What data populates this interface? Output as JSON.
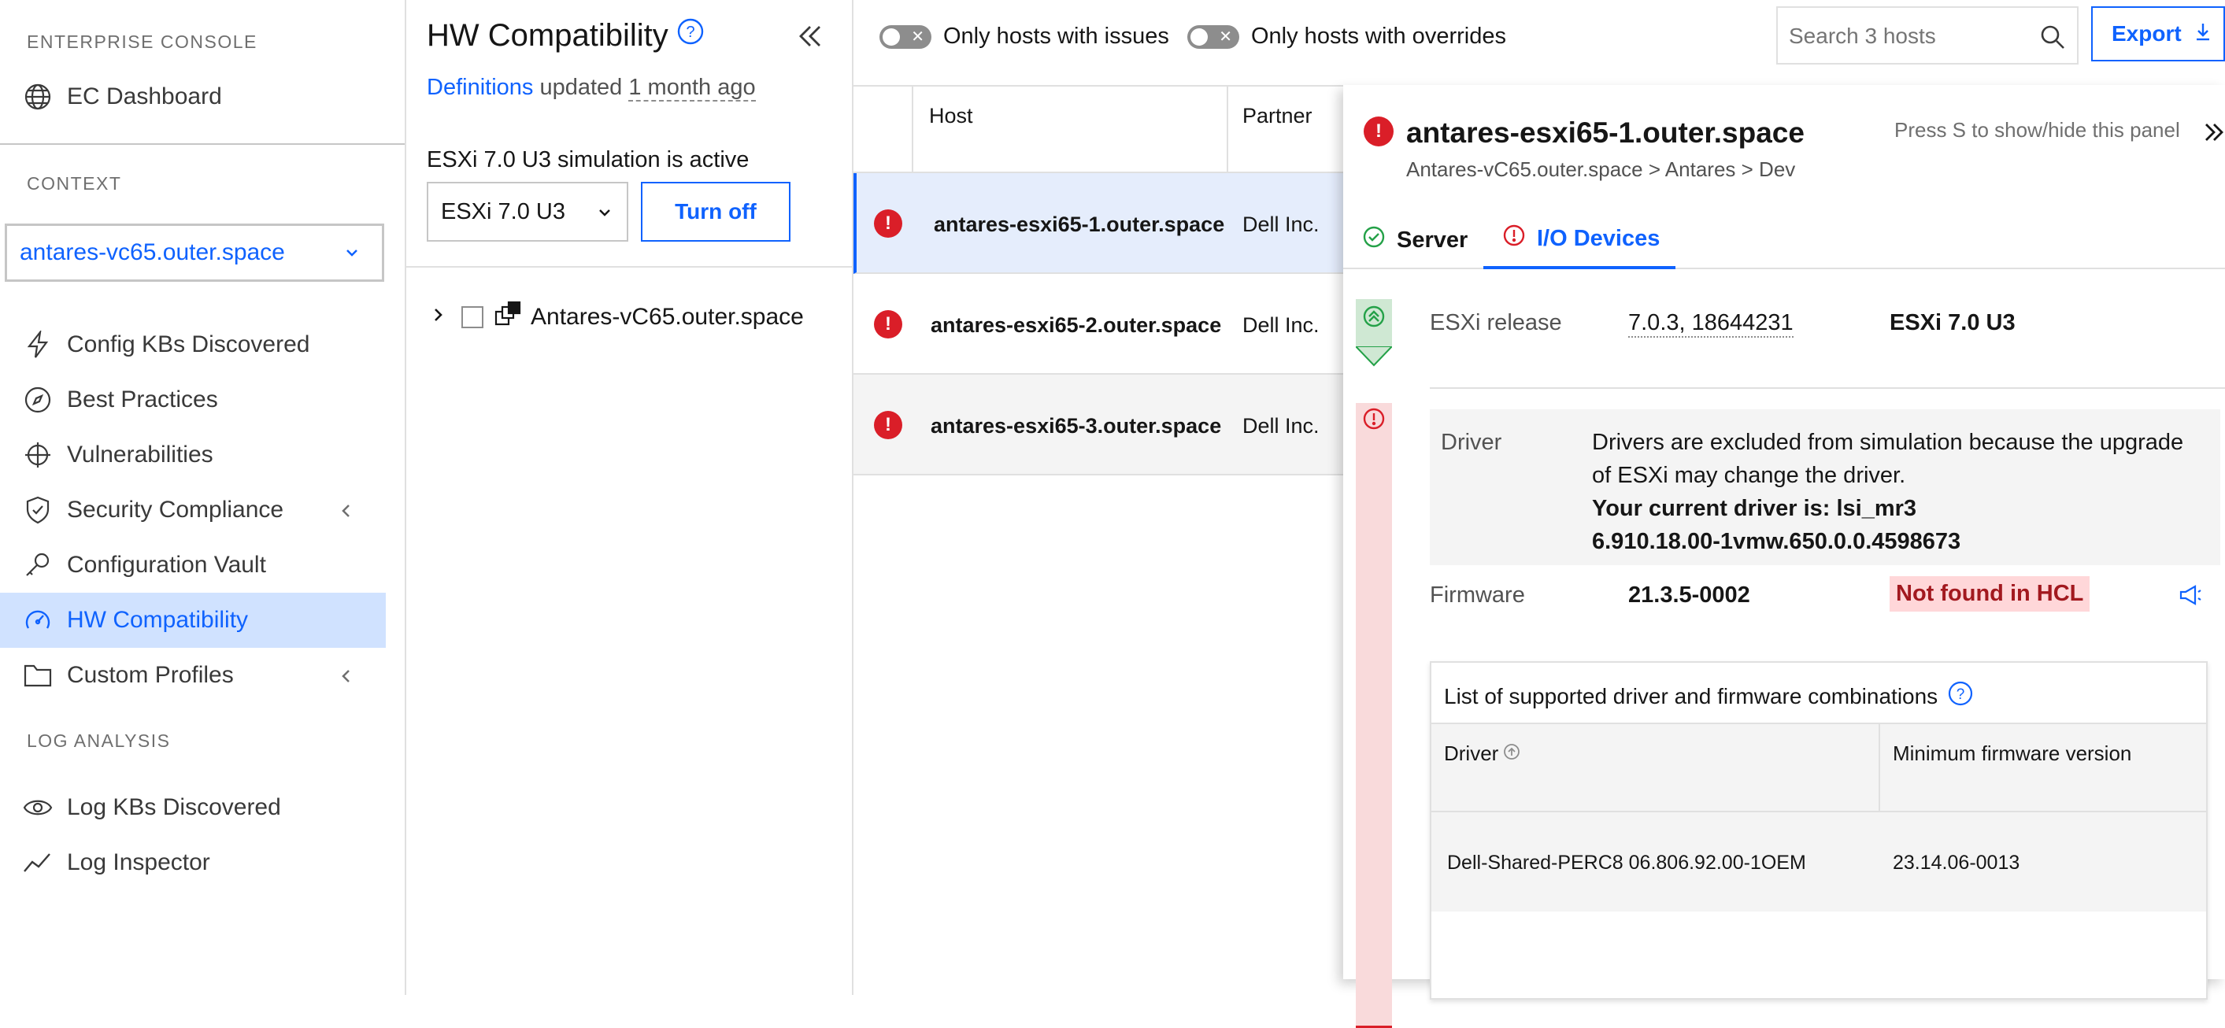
{
  "sidebar": {
    "section_enterprise": "ENTERPRISE CONSOLE",
    "ec_dashboard": "EC Dashboard",
    "section_context": "CONTEXT",
    "context_value": "antares-vc65.outer.space",
    "items": [
      {
        "label": "Config KBs Discovered"
      },
      {
        "label": "Best Practices"
      },
      {
        "label": "Vulnerabilities"
      },
      {
        "label": "Security Compliance"
      },
      {
        "label": "Configuration Vault"
      },
      {
        "label": "HW Compatibility"
      },
      {
        "label": "Custom Profiles"
      }
    ],
    "section_log": "LOG ANALYSIS",
    "log_items": [
      {
        "label": "Log KBs Discovered"
      },
      {
        "label": "Log Inspector"
      }
    ]
  },
  "panel": {
    "title": "HW Compatibility",
    "definitions_link": "Definitions",
    "updated_text": "updated",
    "updated_when": "1 month ago",
    "simulation_text": "ESXi 7.0 U3 simulation is active",
    "simulation_select": "ESXi 7.0 U3",
    "turn_off": "Turn off",
    "tree_node": "Antares-vC65.outer.space"
  },
  "toolbar": {
    "toggle_issues": "Only hosts with issues",
    "toggle_overrides": "Only hosts with overrides",
    "search_placeholder": "Search 3 hosts",
    "export": "Export"
  },
  "table": {
    "col_host": "Host",
    "col_partner": "Partner",
    "rows": [
      {
        "host": "antares-esxi65-1.outer.space",
        "partner": "Dell Inc."
      },
      {
        "host": "antares-esxi65-2.outer.space",
        "partner": "Dell Inc."
      },
      {
        "host": "antares-esxi65-3.outer.space",
        "partner": "Dell Inc."
      }
    ]
  },
  "detail": {
    "title": "antares-esxi65-1.outer.space",
    "breadcrumb": "Antares-vC65.outer.space > Antares > Dev",
    "hint": "Press S to show/hide this panel",
    "tab_server": "Server",
    "tab_io": "I/O Devices",
    "esxi_release_label": "ESXi release",
    "esxi_release_value": "7.0.3, 18644231",
    "esxi_release_target": "ESXi 7.0 U3",
    "driver_label": "Driver",
    "driver_note_1": "Drivers are excluded from simulation because the upgrade",
    "driver_note_2": "of ESXi may change the driver.",
    "driver_current_1": "Your current driver is: lsi_mr3",
    "driver_current_2": "6.910.18.00-1vmw.650.0.0.4598673",
    "firmware_label": "Firmware",
    "firmware_value": "21.3.5-0002",
    "firmware_status": "Not found in HCL",
    "combos_title": "List of supported driver and firmware combinations",
    "combos_col_driver": "Driver",
    "combos_col_fw": "Minimum firmware version",
    "combos_rows": [
      {
        "driver": "Dell-Shared-PERC8 06.806.92.00-1OEM",
        "fw": "23.14.06-0013"
      }
    ]
  },
  "colors": {
    "accent": "#0f62fe",
    "error": "#da1e28",
    "success": "#24a148",
    "active_bg": "#d0e2ff",
    "not_found_bg": "#ffd7d9"
  }
}
